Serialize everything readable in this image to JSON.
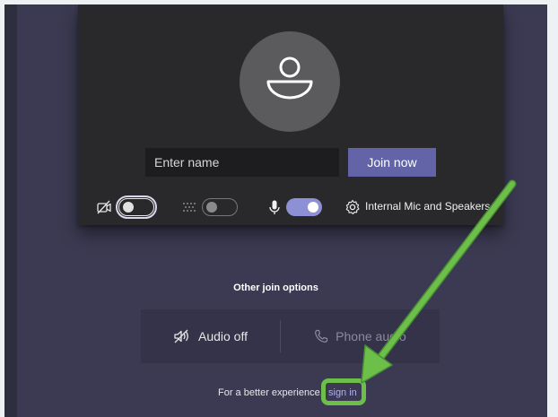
{
  "prejoin": {
    "name_placeholder": "Enter name",
    "join_label": "Join now",
    "device_label": "Internal Mic and Speakers",
    "video_toggle": {
      "state": "off",
      "icon": "camera-off-icon"
    },
    "background_toggle": {
      "state": "off",
      "icon": "background-blur-icon"
    },
    "mic_toggle": {
      "state": "on",
      "icon": "microphone-icon"
    }
  },
  "other_options": {
    "heading": "Other join options",
    "audio_off_label": "Audio off",
    "phone_audio_label": "Phone audio"
  },
  "footer": {
    "prefix": "For a better experience,",
    "signin_label": "sign in"
  },
  "colors": {
    "background": "#3b3a52",
    "preview_panel": "#29292b",
    "accent": "#6264a7",
    "toggle_on": "#8e90d6",
    "link": "#aeb0f0",
    "annotation": "#6cc04a"
  }
}
